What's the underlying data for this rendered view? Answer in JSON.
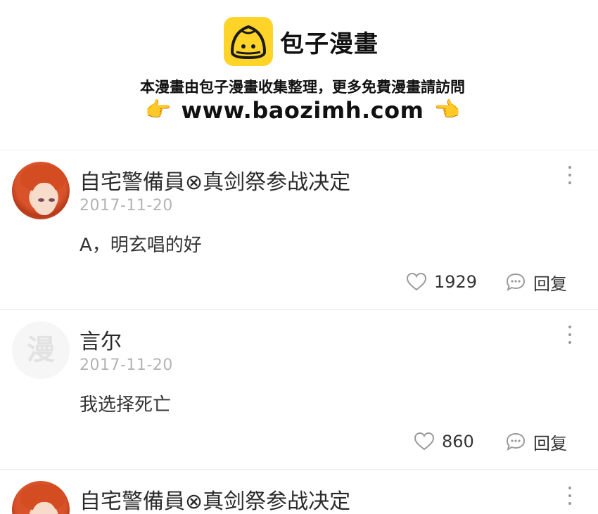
{
  "header": {
    "logo_text": "包子漫畫",
    "tagline": "本漫畫由包子漫畫收集整理，更多免費漫畫請訪問",
    "url": "www.baozimh.com",
    "hand_left": "👉",
    "hand_right": "👈"
  },
  "comments": [
    {
      "username": "自宅警備員⊗真剑祭参战决定",
      "date": "2017-11-20",
      "text": "A，明玄唱的好",
      "likes": "1929",
      "reply_label": "回复",
      "avatar": "anime-character-avatar"
    },
    {
      "username": "言尔",
      "date": "2017-11-20",
      "text": "我选择死亡",
      "likes": "860",
      "reply_label": "回复",
      "avatar": "default-avatar",
      "avatar_placeholder": "漫"
    },
    {
      "username": "自宅警備員⊗真剑祭参战决定",
      "avatar": "anime-character-avatar"
    }
  ],
  "colors": {
    "brand_yellow": "#ffd429",
    "date_gray": "#b4b4b4",
    "icon_gray": "#9a9a9a"
  }
}
